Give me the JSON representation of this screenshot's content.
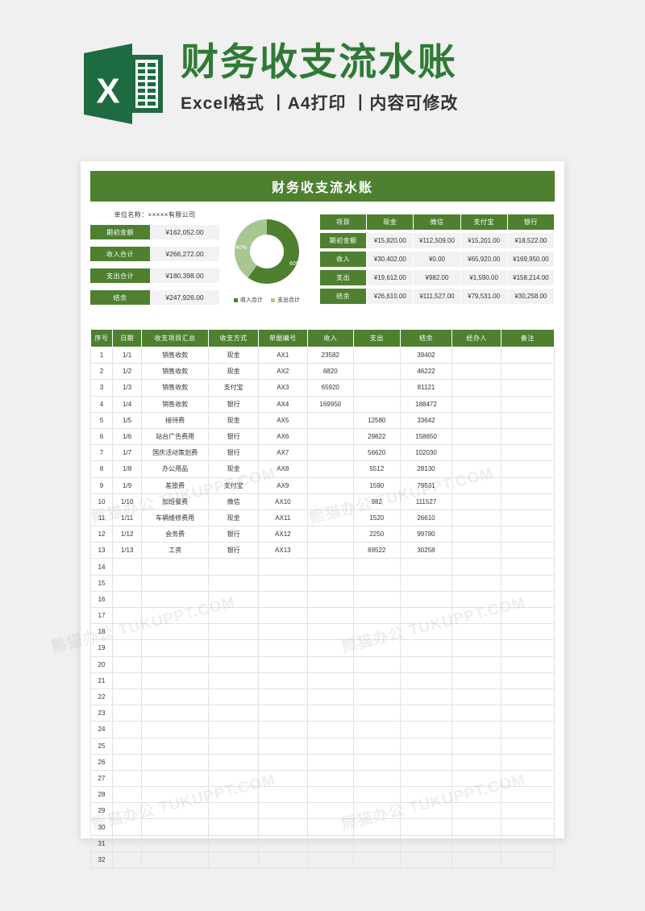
{
  "banner": {
    "logo_icon": "excel-logo-icon",
    "title": "财务收支流水账",
    "subtitle": "Excel格式 丨A4打印 丨内容可修改"
  },
  "sheet": {
    "title": "财务收支流水账",
    "unit_name": "单位名称：×××××有限公司"
  },
  "kpis": [
    {
      "label": "期初金额",
      "value": "¥162,052.00"
    },
    {
      "label": "收入合计",
      "value": "¥266,272.00"
    },
    {
      "label": "支出合计",
      "value": "¥180,398.00"
    },
    {
      "label": "结余",
      "value": "¥247,926.00"
    }
  ],
  "chart_data": {
    "type": "pie",
    "title": "",
    "labels": [
      "收入合计",
      "支出合计"
    ],
    "values": [
      60,
      40
    ],
    "data_labels": [
      "60%",
      "40%"
    ],
    "colors": [
      "#4e8030",
      "#a8c68f"
    ],
    "legend_position": "bottom",
    "donut": true
  },
  "summary_table": {
    "columns": [
      "项目",
      "现金",
      "微信",
      "支付宝",
      "银行"
    ],
    "rows": [
      {
        "label": "期初金额",
        "values": [
          "¥15,820.00",
          "¥112,509.00",
          "¥15,201.00",
          "¥18,522.00"
        ]
      },
      {
        "label": "收入",
        "values": [
          "¥30,402.00",
          "¥0.00",
          "¥65,920.00",
          "¥169,950.00"
        ]
      },
      {
        "label": "支出",
        "values": [
          "¥19,612.00",
          "¥982.00",
          "¥1,590.00",
          "¥158,214.00"
        ]
      },
      {
        "label": "结余",
        "values": [
          "¥26,610.00",
          "¥111,527.00",
          "¥79,531.00",
          "¥30,258.00"
        ]
      }
    ]
  },
  "ledger": {
    "columns": [
      "序号",
      "日期",
      "收支项目汇总",
      "收支方式",
      "单据编号",
      "收入",
      "支出",
      "结余",
      "经办人",
      "备注"
    ],
    "rows": [
      [
        "1",
        "1/1",
        "销售收款",
        "现金",
        "AX1",
        "23582",
        "",
        "39402",
        "",
        ""
      ],
      [
        "2",
        "1/2",
        "销售收款",
        "现金",
        "AX2",
        "6820",
        "",
        "46222",
        "",
        ""
      ],
      [
        "3",
        "1/3",
        "销售收款",
        "支付宝",
        "AX3",
        "65920",
        "",
        "81121",
        "",
        ""
      ],
      [
        "4",
        "1/4",
        "销售收款",
        "银行",
        "AX4",
        "169950",
        "",
        "188472",
        "",
        ""
      ],
      [
        "5",
        "1/5",
        "接待费",
        "现金",
        "AX5",
        "",
        "12580",
        "33642",
        "",
        ""
      ],
      [
        "6",
        "1/6",
        "站台广告费用",
        "银行",
        "AX6",
        "",
        "29822",
        "158650",
        "",
        ""
      ],
      [
        "7",
        "1/7",
        "国庆活动策划费",
        "银行",
        "AX7",
        "",
        "56620",
        "102030",
        "",
        ""
      ],
      [
        "8",
        "1/8",
        "办公用品",
        "现金",
        "AX8",
        "",
        "5512",
        "28130",
        "",
        ""
      ],
      [
        "9",
        "1/9",
        "差旅费",
        "支付宝",
        "AX9",
        "",
        "1590",
        "79531",
        "",
        ""
      ],
      [
        "10",
        "1/10",
        "加班餐费",
        "微信",
        "AX10",
        "",
        "982",
        "111527",
        "",
        ""
      ],
      [
        "11",
        "1/11",
        "车辆维修费用",
        "现金",
        "AX11",
        "",
        "1520",
        "26610",
        "",
        ""
      ],
      [
        "12",
        "1/12",
        "会务费",
        "银行",
        "AX12",
        "",
        "2250",
        "99780",
        "",
        ""
      ],
      [
        "13",
        "1/13",
        "工资",
        "银行",
        "AX13",
        "",
        "69522",
        "30258",
        "",
        ""
      ],
      [
        "14",
        "",
        "",
        "",
        "",
        "",
        "",
        "",
        "",
        ""
      ],
      [
        "15",
        "",
        "",
        "",
        "",
        "",
        "",
        "",
        "",
        ""
      ],
      [
        "16",
        "",
        "",
        "",
        "",
        "",
        "",
        "",
        "",
        ""
      ],
      [
        "17",
        "",
        "",
        "",
        "",
        "",
        "",
        "",
        "",
        ""
      ],
      [
        "18",
        "",
        "",
        "",
        "",
        "",
        "",
        "",
        "",
        ""
      ],
      [
        "19",
        "",
        "",
        "",
        "",
        "",
        "",
        "",
        "",
        ""
      ],
      [
        "20",
        "",
        "",
        "",
        "",
        "",
        "",
        "",
        "",
        ""
      ],
      [
        "21",
        "",
        "",
        "",
        "",
        "",
        "",
        "",
        "",
        ""
      ],
      [
        "22",
        "",
        "",
        "",
        "",
        "",
        "",
        "",
        "",
        ""
      ],
      [
        "23",
        "",
        "",
        "",
        "",
        "",
        "",
        "",
        "",
        ""
      ],
      [
        "24",
        "",
        "",
        "",
        "",
        "",
        "",
        "",
        "",
        ""
      ],
      [
        "25",
        "",
        "",
        "",
        "",
        "",
        "",
        "",
        "",
        ""
      ],
      [
        "26",
        "",
        "",
        "",
        "",
        "",
        "",
        "",
        "",
        ""
      ],
      [
        "27",
        "",
        "",
        "",
        "",
        "",
        "",
        "",
        "",
        ""
      ],
      [
        "28",
        "",
        "",
        "",
        "",
        "",
        "",
        "",
        "",
        ""
      ],
      [
        "29",
        "",
        "",
        "",
        "",
        "",
        "",
        "",
        "",
        ""
      ],
      [
        "30",
        "",
        "",
        "",
        "",
        "",
        "",
        "",
        "",
        ""
      ],
      [
        "31",
        "",
        "",
        "",
        "",
        "",
        "",
        "",
        "",
        ""
      ],
      [
        "32",
        "",
        "",
        "",
        "",
        "",
        "",
        "",
        "",
        ""
      ]
    ]
  },
  "theme": {
    "accent_green": "#4e8030",
    "light_green": "#a8c68f",
    "title_green": "#2f7a35",
    "cell_grey": "#f2f2f2"
  },
  "watermarks": [
    "熊猫办公 TUKUPPT.COM",
    "熊猫办公 TUKUPPT.COM",
    "熊猫办公 TUKUPPT.COM",
    "熊猫办公 TUKUPPT.COM",
    "熊猫办公 TUKUPPT.COM",
    "熊猫办公 TUKUPPT.COM"
  ]
}
